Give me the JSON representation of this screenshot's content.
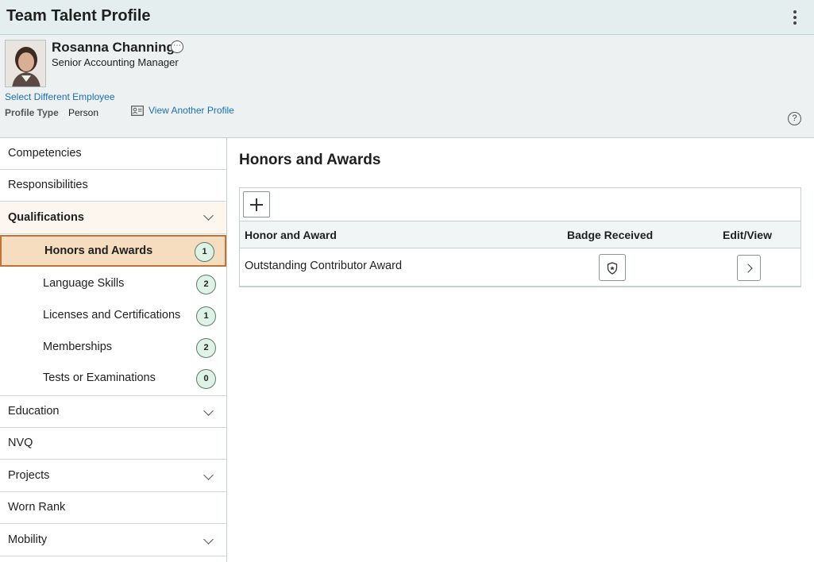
{
  "header": {
    "title": "Team Talent Profile"
  },
  "employee": {
    "name": "Rosanna Channing",
    "related_actions_glyph": "⋯",
    "job_title": "Senior Accounting Manager",
    "select_link": "Select Different Employee",
    "profile_type_label": "Profile Type",
    "profile_type_value": "Person",
    "view_another_link": "View Another Profile",
    "help_glyph": "?"
  },
  "nav": {
    "items": [
      {
        "label": "Competencies"
      },
      {
        "label": "Responsibilities"
      },
      {
        "label": "Qualifications",
        "expanded": true
      },
      {
        "label": "Education"
      },
      {
        "label": "NVQ"
      },
      {
        "label": "Projects"
      },
      {
        "label": "Worn Rank"
      },
      {
        "label": "Mobility"
      }
    ],
    "sub_items": [
      {
        "label": "Honors and Awards",
        "count": "1",
        "selected": true
      },
      {
        "label": "Language Skills",
        "count": "2"
      },
      {
        "label": "Licenses and Certifications",
        "count": "1"
      },
      {
        "label": "Memberships",
        "count": "2"
      },
      {
        "label": "Tests or Examinations",
        "count": "0"
      }
    ]
  },
  "main": {
    "title": "Honors and Awards",
    "columns": [
      "Honor and Award",
      "Badge Received",
      "Edit/View"
    ],
    "rows": [
      {
        "honor": "Outstanding Contributor Award"
      }
    ]
  },
  "colors": {
    "header_bg": "#e5eeee",
    "selected_bg": "#f6ddbf",
    "selected_border": "#c1743a",
    "link": "#1a6fb7",
    "count_bg": "#dff2e6"
  }
}
